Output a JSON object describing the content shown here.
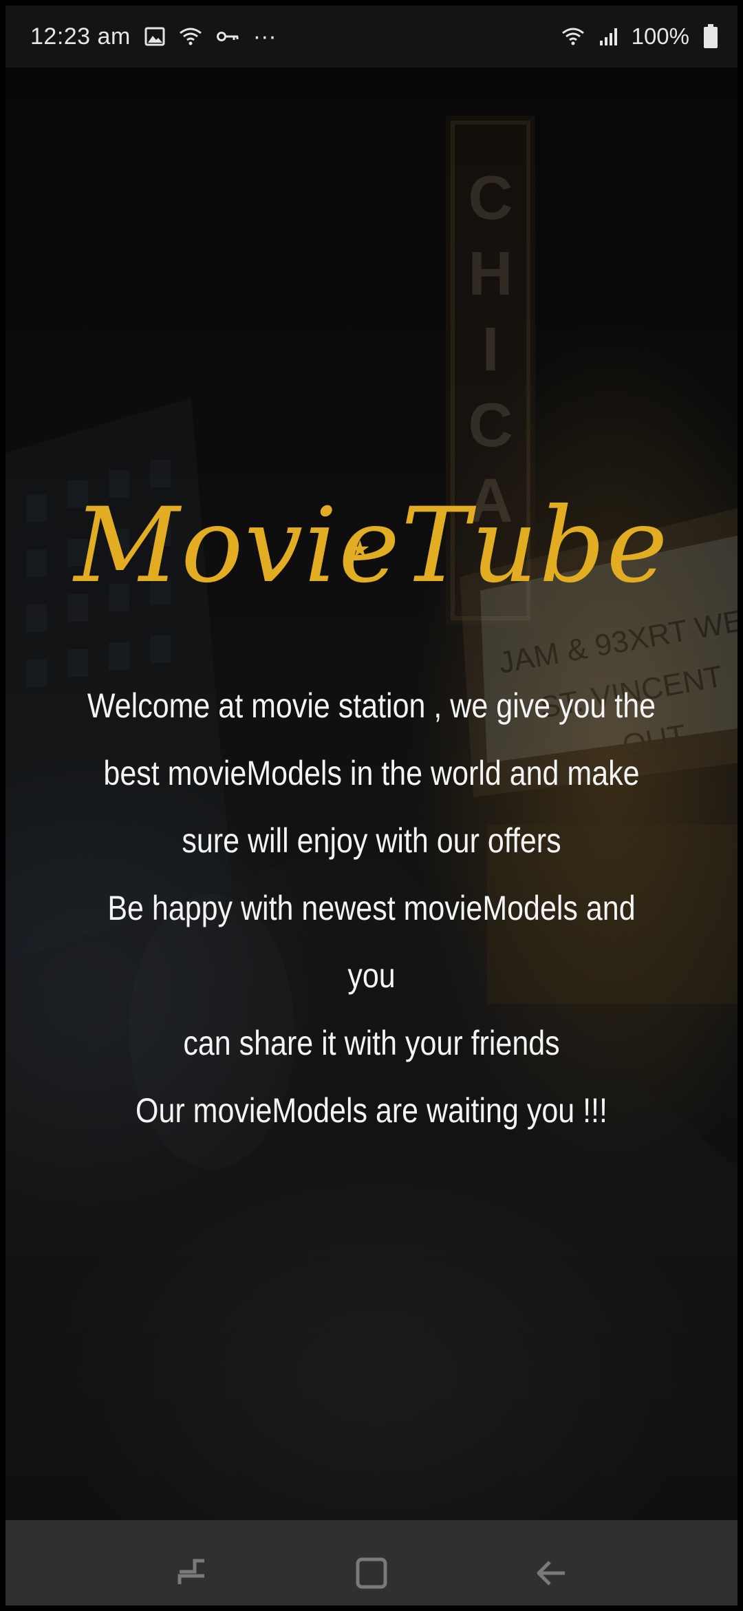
{
  "status_bar": {
    "time": "12:23 am",
    "more": "···",
    "battery": "100%",
    "left_icons": [
      "image-icon",
      "wifi-icon",
      "vpn-key-icon",
      "more-dots-icon"
    ],
    "right_icons": [
      "wifi-icon",
      "signal-icon",
      "battery-icon"
    ]
  },
  "app": {
    "logo": "MovieTube",
    "accent_color": "#e2ac23",
    "welcome_text": "Welcome at movie station , we give you the\nbest movieModels in the world and make\nsure will enjoy with our offers\nBe happy with newest movieModels and you\ncan share it with your friends\nOur movieModels are waiting you !!!"
  },
  "nav_bar": {
    "buttons": [
      "recent-apps-icon",
      "home-icon",
      "back-icon"
    ]
  }
}
